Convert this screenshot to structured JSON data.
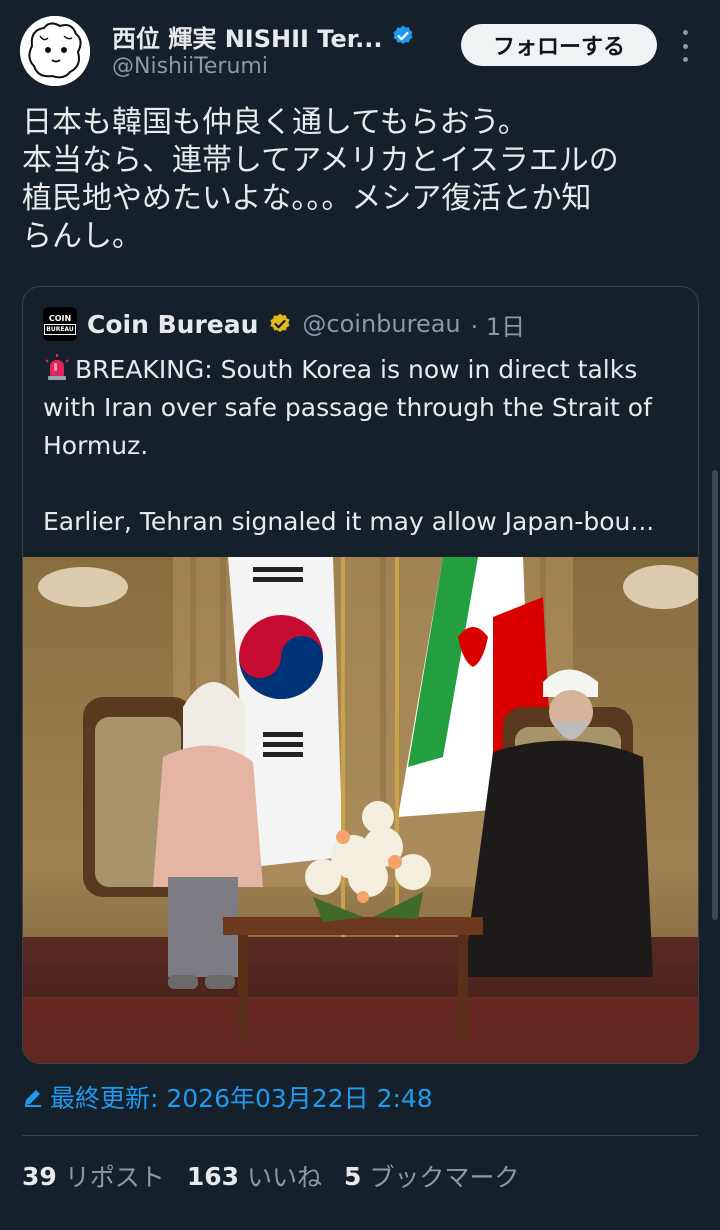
{
  "author": {
    "display_name": "西位 輝実 NISHII Ter...",
    "handle": "@NishiiTerumi",
    "follow_label": "フォローする"
  },
  "tweet": {
    "lines": [
      "日本も韓国も仲良く通してもらおう。",
      "本当なら、連帯してアメリカとイスラエルの",
      "植民地やめたいよな。。。メシア復活とか知",
      "らんし。"
    ]
  },
  "quote": {
    "logo_text_top": "COIN",
    "logo_text_bottom": "BUREAU",
    "name": "Coin Bureau",
    "handle": "@coinbureau",
    "time": "· 1日",
    "lines": [
      "BREAKING: South Korea is now in direct talks",
      "with Iran over safe passage through the Strait of",
      "Hormuz.",
      "",
      "Earlier, Tehran signaled it may allow Japan-bou..."
    ]
  },
  "updated": {
    "label": "最終更新: 2026年03月22日 2:48"
  },
  "stats": {
    "reposts_count": "39",
    "reposts_label": "リポスト",
    "likes_count": "163",
    "likes_label": "いいね",
    "bookmarks_count": "5",
    "bookmarks_label": "ブックマーク"
  },
  "icons": {
    "verified": "verified-badge-icon",
    "more": "more-vertical-icon",
    "edit": "pencil-icon",
    "siren": "rotating-light-icon"
  },
  "colors": {
    "background": "#15202b",
    "text": "#e7e9ea",
    "muted": "#8b98a5",
    "accent": "#1d9bf0",
    "gold_badge": "#e2b719",
    "border": "#38444d"
  }
}
